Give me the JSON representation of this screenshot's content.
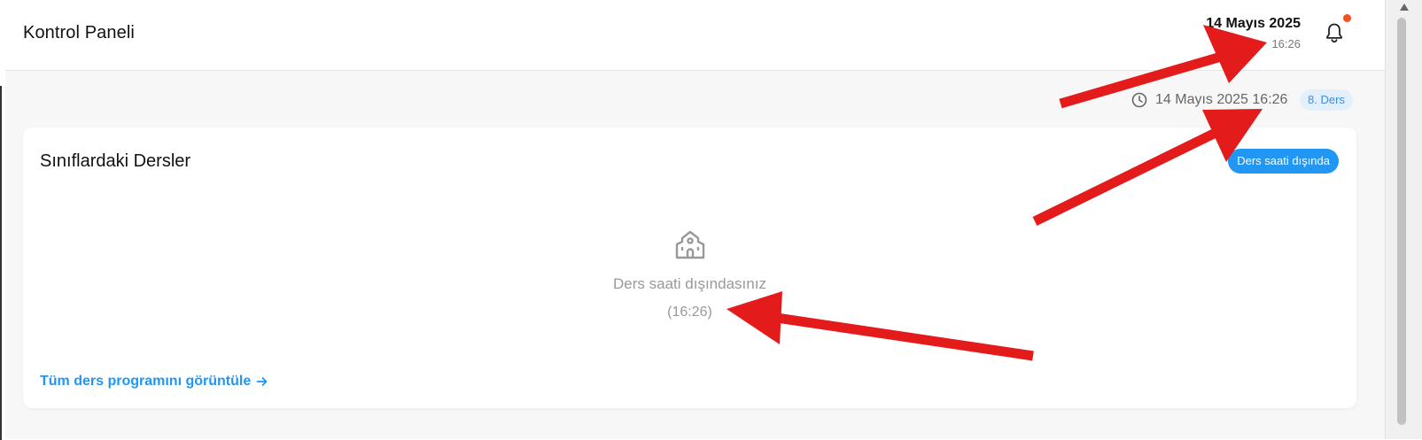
{
  "header": {
    "title": "Kontrol Paneli",
    "date": "14 Mayıs 2025",
    "time": "16:26"
  },
  "now_bar": {
    "datetime": "14 Mayıs 2025 16:26",
    "period_badge": "8. Ders"
  },
  "classes_card": {
    "title": "Sınıflardaki Dersler",
    "status_chip": "Ders saati dışında",
    "empty_message": "Ders saati dışındasınız",
    "empty_time": "(16:26)",
    "view_all_label": "Tüm ders programını görüntüle"
  },
  "icons": {
    "notification": "bell-icon",
    "clock": "clock-icon",
    "school": "school-icon",
    "arrow": "arrow-right-icon"
  },
  "colors": {
    "accent": "#2196f3",
    "notification_dot": "#f4511e",
    "annotation_arrow": "#e31b1b"
  }
}
